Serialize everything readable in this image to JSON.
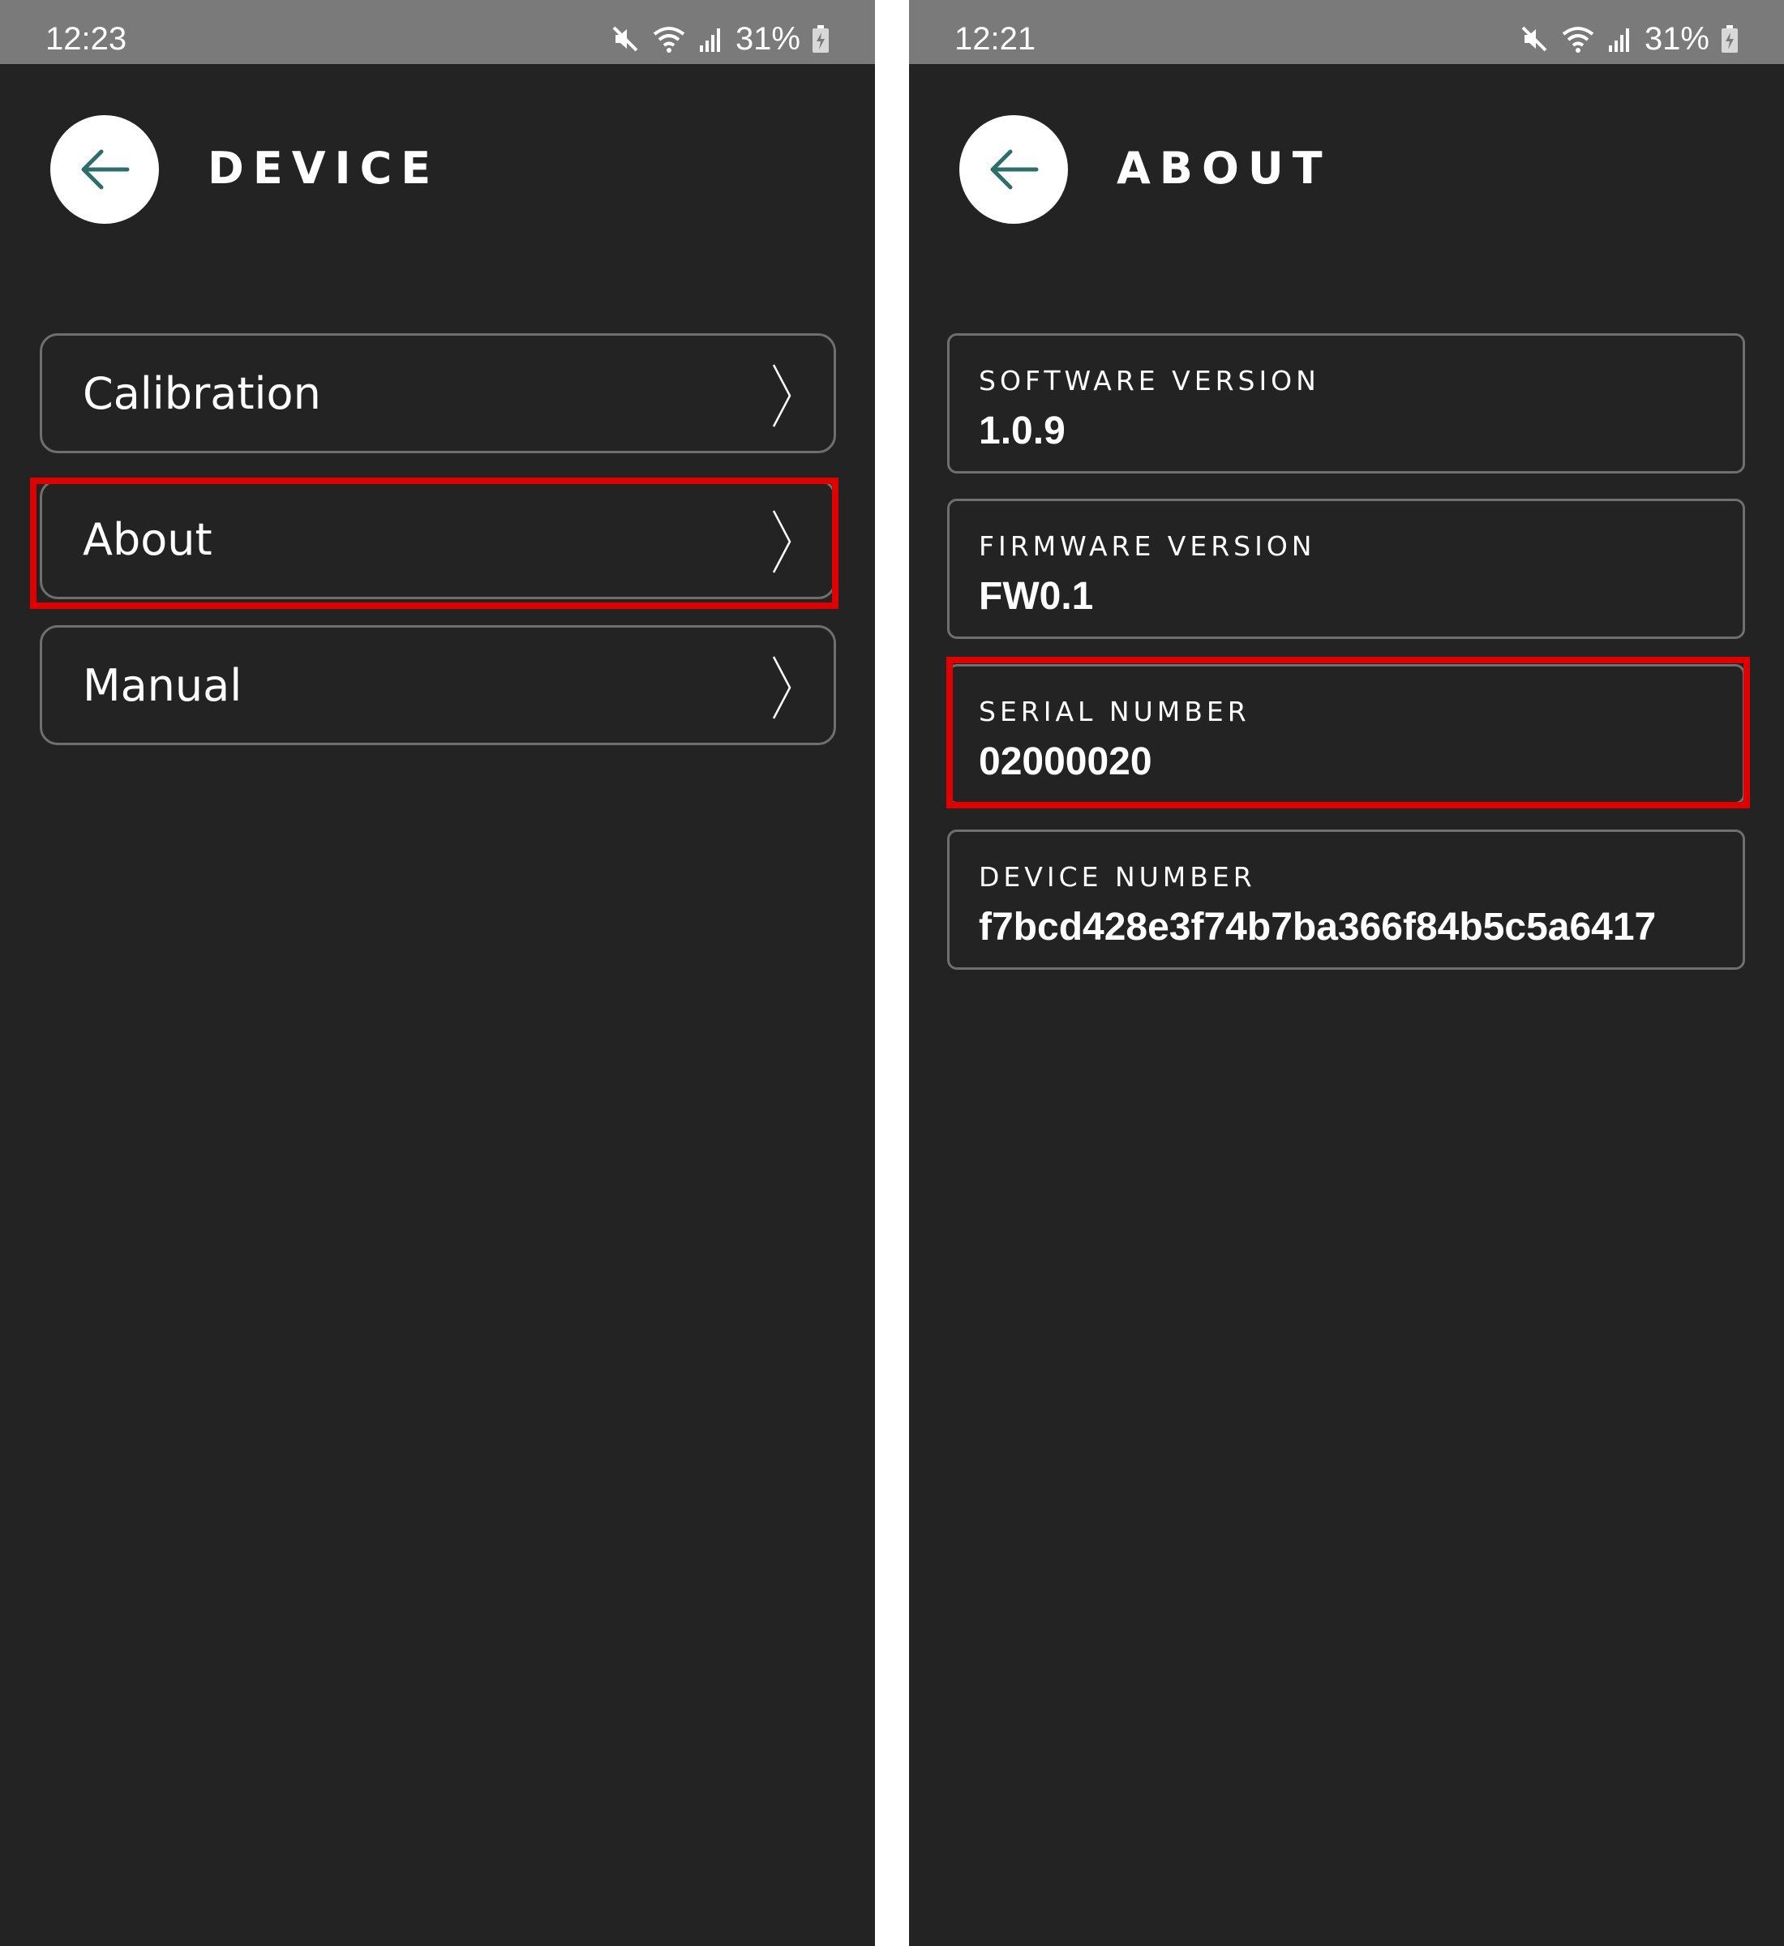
{
  "left_screen": {
    "status": {
      "time": "12:23",
      "battery": "31%"
    },
    "title": "DEVICE",
    "menu": [
      {
        "label": "Calibration"
      },
      {
        "label": "About"
      },
      {
        "label": "Manual"
      }
    ]
  },
  "right_screen": {
    "status": {
      "time": "12:21",
      "battery": "31%"
    },
    "title": "ABOUT",
    "fields": [
      {
        "label": "SOFTWARE VERSION",
        "value": "1.0.9"
      },
      {
        "label": "FIRMWARE VERSION",
        "value": "FW0.1"
      },
      {
        "label": "SERIAL NUMBER",
        "value": "02000020"
      },
      {
        "label": "DEVICE NUMBER",
        "value": "f7bcd428e3f74b7ba366f84b5c5a6417"
      }
    ]
  },
  "icons": {
    "back": "arrow-left-icon",
    "chevron": "chevron-right-icon",
    "mute": "mute-icon",
    "wifi": "wifi-icon",
    "signal": "signal-icon",
    "battery": "battery-charging-icon"
  },
  "colors": {
    "background": "#232323",
    "statusbar": "#7a7a7a",
    "accent": "#2e6e6a",
    "card_border": "#6f6f6f",
    "highlight": "#e00000"
  }
}
